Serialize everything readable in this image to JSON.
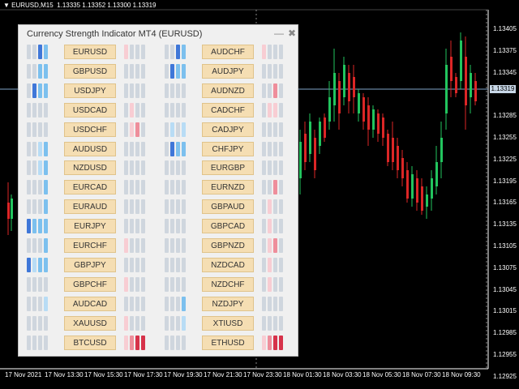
{
  "chart": {
    "symbol_text": "▼ EURUSD,M15  1.13335 1.13352 1.13300 1.13319",
    "current_price": "1.13319",
    "price_ticks": [
      "1.13405",
      "1.13375",
      "1.13345",
      "1.13319",
      "1.13285",
      "1.13255",
      "1.13225",
      "1.13195",
      "1.13165",
      "1.13135",
      "1.13105",
      "1.13075",
      "1.13045",
      "1.13015",
      "1.12985",
      "1.12955",
      "1.12925"
    ],
    "time_ticks": [
      "17 Nov 2021",
      "17 Nov 13:30",
      "17 Nov 15:30",
      "17 Nov 17:30",
      "17 Nov 19:30",
      "17 Nov 21:30",
      "17 Nov 23:30",
      "18 Nov 01:30",
      "18 Nov 03:30",
      "18 Nov 05:30",
      "18 Nov 07:30",
      "18 Nov 09:30"
    ],
    "colors": {
      "up": "#22c55e",
      "down": "#dc2626",
      "grid": "#888888",
      "price_line": "#7fa3c9"
    }
  },
  "panel": {
    "title": "Currency Strength Indicator MT4 (EURUSD)",
    "min_icon": "minimize-icon",
    "close_icon": "close-icon",
    "min_glyph": "—",
    "close_glyph": "✖",
    "colors": {
      "blue": [
        "#cfd6de",
        "#b8dcf5",
        "#7cc0ee",
        "#3f77d8"
      ],
      "red": [
        "#cfd6de",
        "#f8cdd3",
        "#ee8e9b",
        "#d6324a"
      ]
    },
    "left_pairs": [
      {
        "label": "EURUSD",
        "blue": [
          0,
          0,
          3,
          2
        ],
        "red": [
          1,
          0,
          0,
          0
        ]
      },
      {
        "label": "GBPUSD",
        "blue": [
          0,
          0,
          2,
          2
        ],
        "red": [
          0,
          0,
          0,
          0
        ]
      },
      {
        "label": "USDJPY",
        "blue": [
          0,
          3,
          2,
          2
        ],
        "red": [
          0,
          0,
          0,
          0
        ]
      },
      {
        "label": "USDCAD",
        "blue": [
          0,
          0,
          0,
          0
        ],
        "red": [
          0,
          1,
          0,
          0
        ]
      },
      {
        "label": "USDCHF",
        "blue": [
          0,
          0,
          0,
          0
        ],
        "red": [
          0,
          1,
          2,
          0
        ]
      },
      {
        "label": "AUDUSD",
        "blue": [
          0,
          0,
          1,
          2
        ],
        "red": [
          0,
          0,
          0,
          0
        ]
      },
      {
        "label": "NZDUSD",
        "blue": [
          0,
          0,
          1,
          2
        ],
        "red": [
          0,
          0,
          0,
          0
        ]
      },
      {
        "label": "EURCAD",
        "blue": [
          0,
          0,
          0,
          2
        ],
        "red": [
          0,
          0,
          0,
          0
        ]
      },
      {
        "label": "EURAUD",
        "blue": [
          0,
          0,
          0,
          2
        ],
        "red": [
          0,
          0,
          0,
          0
        ]
      },
      {
        "label": "EURJPY",
        "blue": [
          3,
          2,
          2,
          2
        ],
        "red": [
          0,
          0,
          0,
          0
        ]
      },
      {
        "label": "EURCHF",
        "blue": [
          0,
          0,
          0,
          2
        ],
        "red": [
          1,
          0,
          0,
          0
        ]
      },
      {
        "label": "GBPJPY",
        "blue": [
          3,
          1,
          2,
          2
        ],
        "red": [
          0,
          0,
          0,
          0
        ]
      },
      {
        "label": "GBPCHF",
        "blue": [
          0,
          0,
          0,
          0
        ],
        "red": [
          1,
          0,
          0,
          0
        ]
      },
      {
        "label": "AUDCAD",
        "blue": [
          0,
          0,
          0,
          1
        ],
        "red": [
          0,
          0,
          0,
          0
        ]
      },
      {
        "label": "XAUUSD",
        "blue": [
          0,
          0,
          0,
          0
        ],
        "red": [
          1,
          0,
          0,
          0
        ]
      },
      {
        "label": "BTCUSD",
        "blue": [
          0,
          0,
          0,
          0
        ],
        "red": [
          1,
          2,
          3,
          3
        ]
      }
    ],
    "right_pairs": [
      {
        "label": "AUDCHF",
        "blue": [
          0,
          0,
          3,
          2
        ],
        "red": [
          1,
          0,
          0,
          0
        ]
      },
      {
        "label": "AUDJPY",
        "blue": [
          0,
          3,
          2,
          2
        ],
        "red": [
          0,
          0,
          0,
          0
        ]
      },
      {
        "label": "AUDNZD",
        "blue": [
          0,
          0,
          0,
          0
        ],
        "red": [
          0,
          0,
          2,
          0
        ]
      },
      {
        "label": "CADCHF",
        "blue": [
          0,
          0,
          0,
          0
        ],
        "red": [
          0,
          1,
          1,
          0
        ]
      },
      {
        "label": "CADJPY",
        "blue": [
          0,
          1,
          0,
          1
        ],
        "red": [
          0,
          0,
          0,
          0
        ]
      },
      {
        "label": "CHFJPY",
        "blue": [
          0,
          3,
          2,
          2
        ],
        "red": [
          0,
          0,
          0,
          0
        ]
      },
      {
        "label": "EURGBP",
        "blue": [
          0,
          0,
          0,
          0
        ],
        "red": [
          0,
          0,
          0,
          0
        ]
      },
      {
        "label": "EURNZD",
        "blue": [
          0,
          0,
          0,
          0
        ],
        "red": [
          0,
          0,
          2,
          0
        ]
      },
      {
        "label": "GBPAUD",
        "blue": [
          0,
          0,
          0,
          0
        ],
        "red": [
          0,
          1,
          0,
          0
        ]
      },
      {
        "label": "GBPCAD",
        "blue": [
          0,
          0,
          0,
          0
        ],
        "red": [
          0,
          1,
          0,
          0
        ]
      },
      {
        "label": "GBPNZD",
        "blue": [
          0,
          0,
          0,
          0
        ],
        "red": [
          0,
          1,
          2,
          0
        ]
      },
      {
        "label": "NZDCAD",
        "blue": [
          0,
          0,
          0,
          0
        ],
        "red": [
          0,
          1,
          0,
          0
        ]
      },
      {
        "label": "NZDCHF",
        "blue": [
          0,
          0,
          0,
          0
        ],
        "red": [
          0,
          1,
          0,
          0
        ]
      },
      {
        "label": "NZDJPY",
        "blue": [
          0,
          0,
          0,
          2
        ],
        "red": [
          0,
          0,
          0,
          0
        ]
      },
      {
        "label": "XTIUSD",
        "blue": [
          0,
          0,
          0,
          1
        ],
        "red": [
          0,
          0,
          0,
          0
        ]
      },
      {
        "label": "ETHUSD",
        "blue": [
          0,
          0,
          0,
          0
        ],
        "red": [
          1,
          2,
          3,
          3
        ]
      }
    ]
  }
}
